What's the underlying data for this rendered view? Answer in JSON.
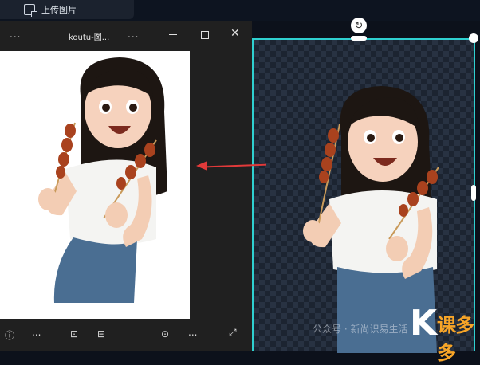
{
  "app": {
    "upload_label": "上传图片"
  },
  "viewer": {
    "title": "koutu-图...",
    "more_left": "...",
    "more_mid": "...",
    "toolbar": {
      "more": "..."
    }
  },
  "watermark": {
    "text": "公众号 · 新尚识易生活",
    "logo_letter": "K",
    "logo_text": "课多多"
  },
  "colors": {
    "selection": "#2fd0d0",
    "arrow": "#e23a3a",
    "logo_orange": "#f7a528"
  }
}
